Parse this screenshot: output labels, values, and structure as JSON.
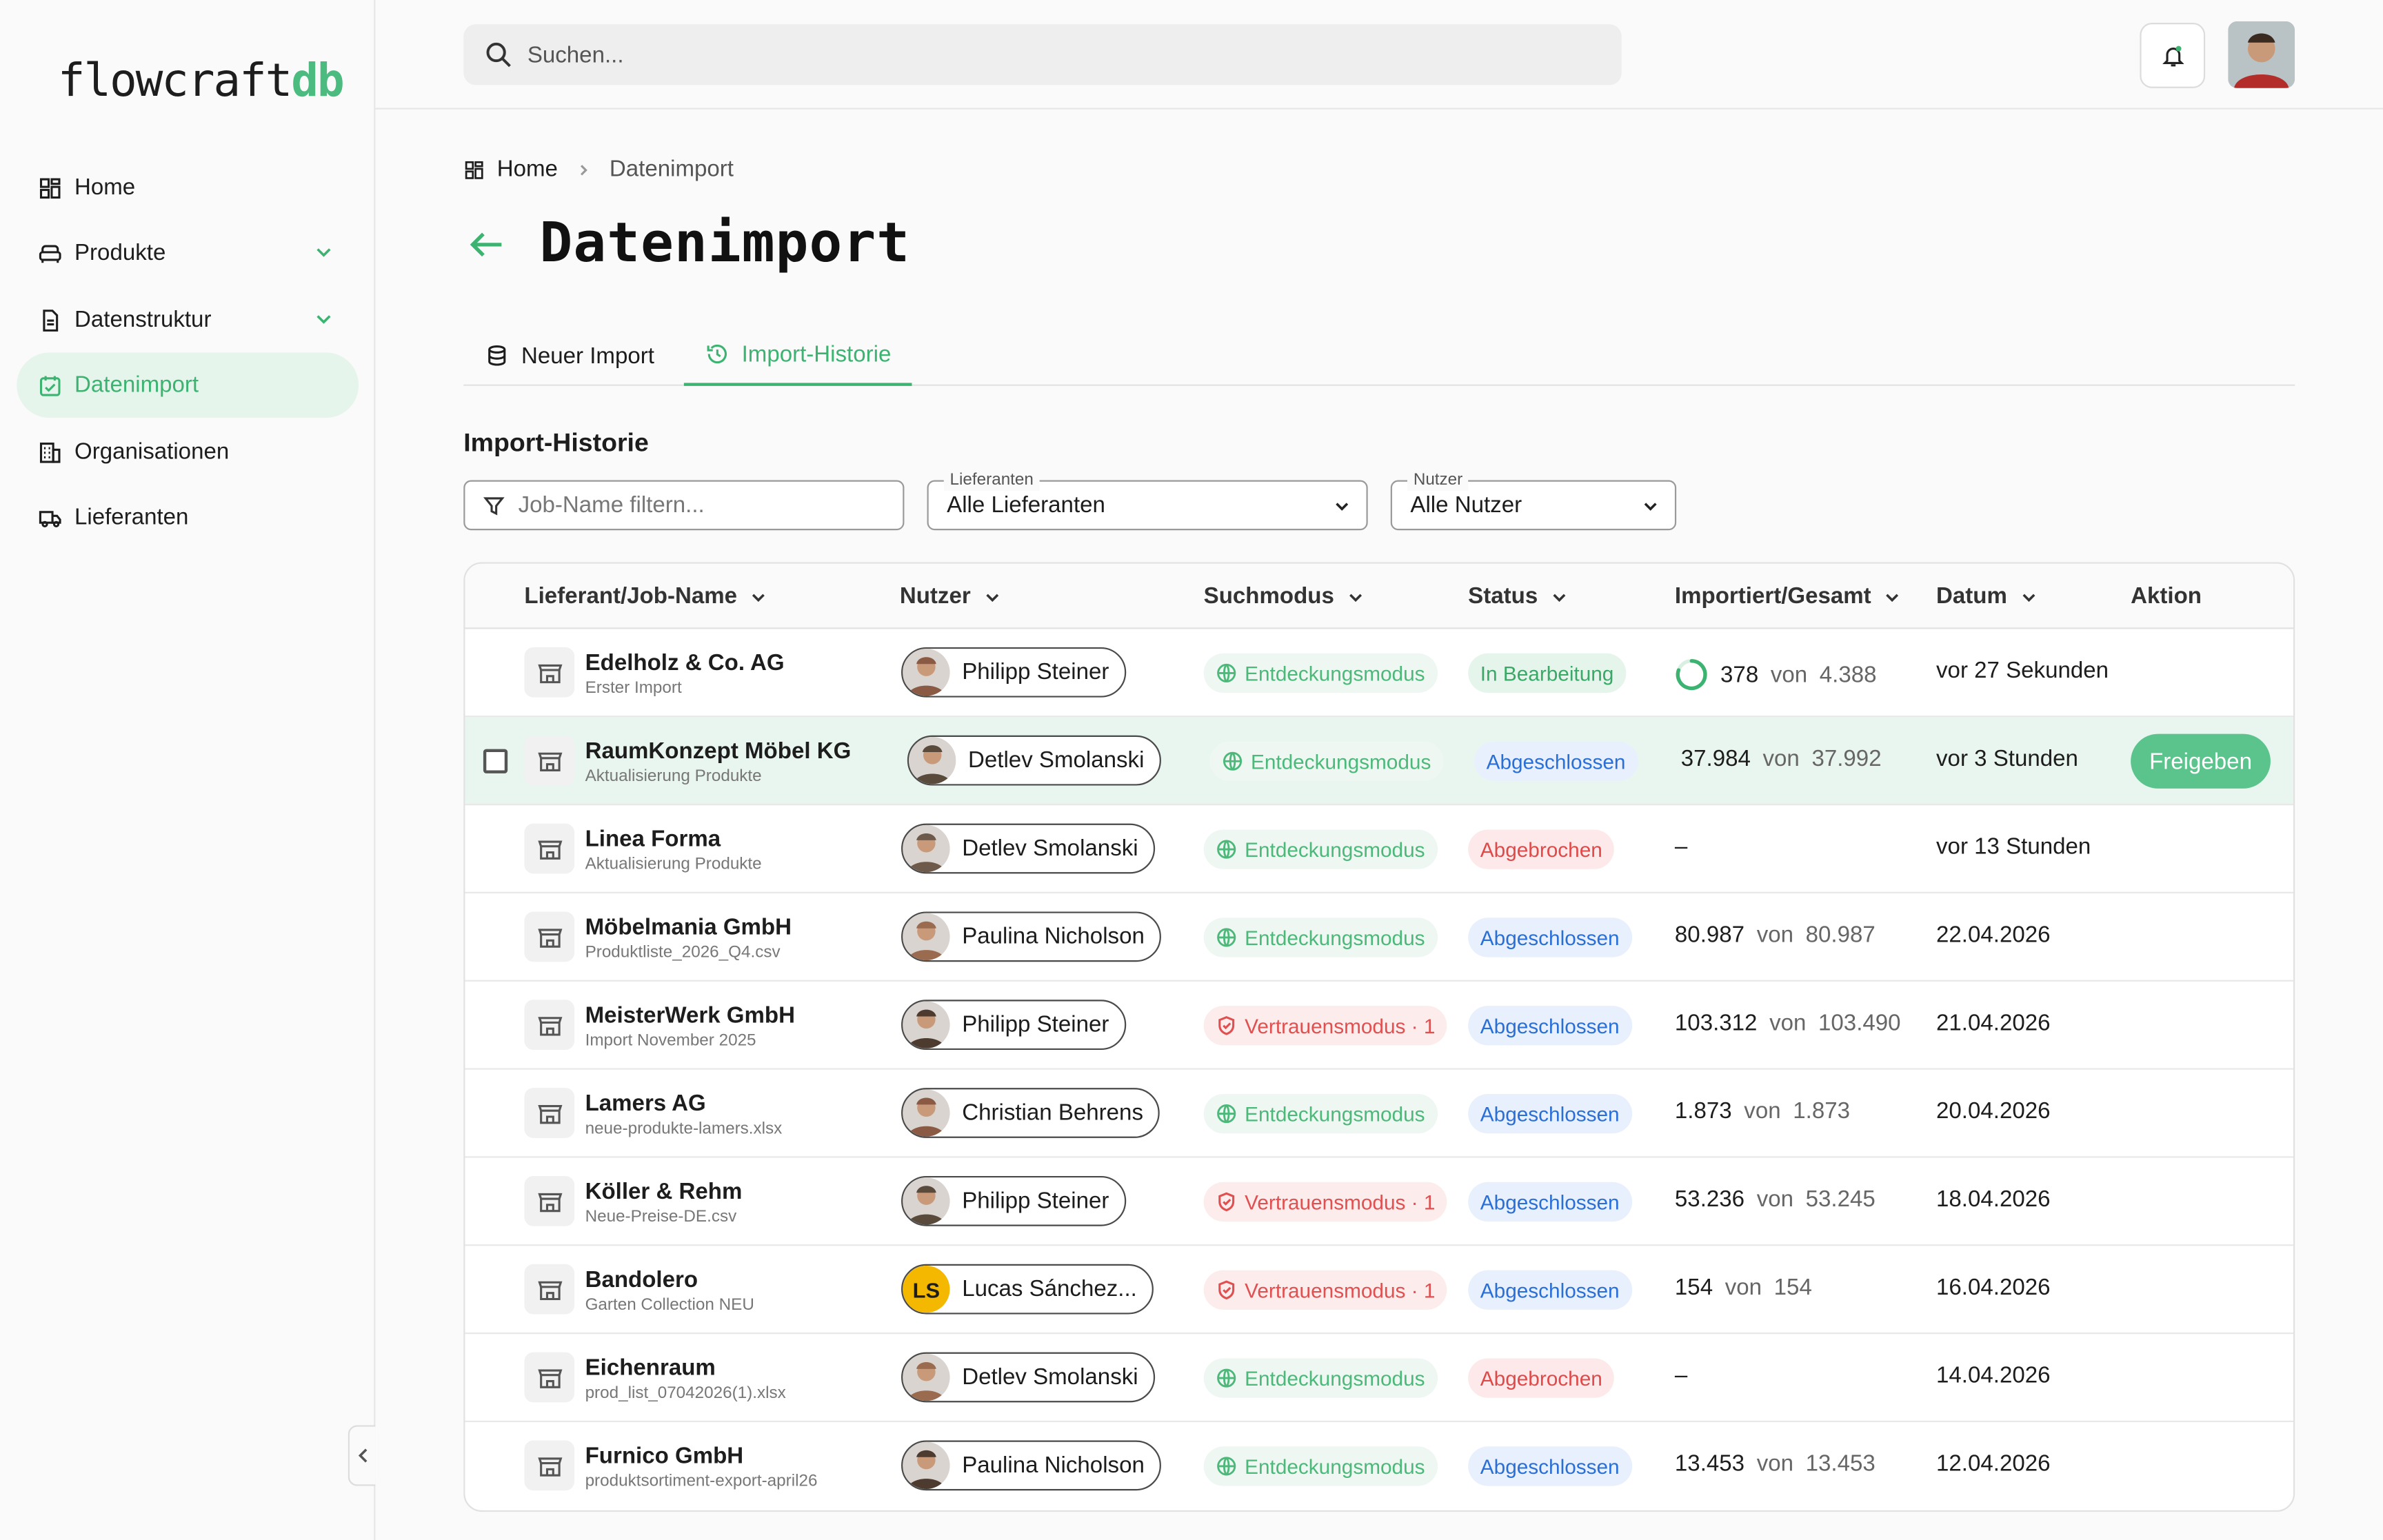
{
  "app": {
    "logo_text": "flowcraft",
    "logo_accent": "db",
    "accent_color": "#3cb371"
  },
  "sidebar": {
    "items": [
      {
        "label": "Home",
        "icon": "dashboard-icon",
        "active": false,
        "expandable": false
      },
      {
        "label": "Produkte",
        "icon": "sofa-icon",
        "active": false,
        "expandable": true
      },
      {
        "label": "Datenstruktur",
        "icon": "document-icon",
        "active": false,
        "expandable": true
      },
      {
        "label": "Datenimport",
        "icon": "calendar-import-icon",
        "active": true,
        "expandable": false
      },
      {
        "label": "Organisationen",
        "icon": "building-icon",
        "active": false,
        "expandable": false
      },
      {
        "label": "Lieferanten",
        "icon": "truck-icon",
        "active": false,
        "expandable": false
      }
    ]
  },
  "topbar": {
    "search_placeholder": "Suchen..."
  },
  "breadcrumb": {
    "home": "Home",
    "current": "Datenimport"
  },
  "page": {
    "title": "Datenimport"
  },
  "tabs": [
    {
      "label": "Neuer Import",
      "icon": "database-icon",
      "active": false
    },
    {
      "label": "Import-Historie",
      "icon": "history-icon",
      "active": true
    }
  ],
  "section": {
    "title": "Import-Historie"
  },
  "filters": {
    "job_placeholder": "Job-Name filtern...",
    "supplier_legend": "Lieferanten",
    "supplier_value": "Alle Lieferanten",
    "user_legend": "Nutzer",
    "user_value": "Alle Nutzer"
  },
  "table": {
    "columns": [
      "Lieferant/Job-Name",
      "Nutzer",
      "Suchmodus",
      "Status",
      "Importiert/Gesamt",
      "Datum",
      "Aktion"
    ],
    "von_label": "von",
    "rows": [
      {
        "supplier": "Edelholz & Co. AG",
        "job": "Erster Import",
        "user": "Philipp Steiner",
        "mode": "Entdeckungsmodus",
        "status": "In Bearbeitung",
        "imported": "378",
        "total": "4.388",
        "date": "vor 27 Sekunden",
        "action": ""
      },
      {
        "supplier": "RaumKonzept Möbel KG",
        "job": "Aktualisierung Produkte",
        "user": "Detlev Smolanski",
        "mode": "Entdeckungsmodus",
        "status": "Abgeschlossen",
        "imported": "37.984",
        "total": "37.992",
        "date": "vor 3 Stunden",
        "action": "Freigeben"
      },
      {
        "supplier": "Linea Forma",
        "job": "Aktualisierung Produkte",
        "user": "Detlev Smolanski",
        "mode": "Entdeckungsmodus",
        "status": "Abgebrochen",
        "imported": "–",
        "total": "",
        "date": "vor 13 Stunden",
        "action": ""
      },
      {
        "supplier": "Möbelmania GmbH",
        "job": "Produktliste_2026_Q4.csv",
        "user": "Paulina Nicholson",
        "mode": "Entdeckungsmodus",
        "status": "Abgeschlossen",
        "imported": "80.987",
        "total": "80.987",
        "date": "22.04.2026",
        "action": ""
      },
      {
        "supplier": "MeisterWerk GmbH",
        "job": "Import November 2025",
        "user": "Philipp Steiner",
        "mode": "Vertrauensmodus · 1",
        "status": "Abgeschlossen",
        "imported": "103.312",
        "total": "103.490",
        "date": "21.04.2026",
        "action": ""
      },
      {
        "supplier": "Lamers AG",
        "job": "neue-produkte-lamers.xlsx",
        "user": "Christian Behrens",
        "mode": "Entdeckungsmodus",
        "status": "Abgeschlossen",
        "imported": "1.873",
        "total": "1.873",
        "date": "20.04.2026",
        "action": ""
      },
      {
        "supplier": "Köller & Rehm",
        "job": "Neue-Preise-DE.csv",
        "user": "Philipp Steiner",
        "mode": "Vertrauensmodus · 1",
        "status": "Abgeschlossen",
        "imported": "53.236",
        "total": "53.245",
        "date": "18.04.2026",
        "action": ""
      },
      {
        "supplier": "Bandolero",
        "job": "Garten Collection NEU",
        "user": "Lucas Sánchez...",
        "user_initials": "LS",
        "mode": "Vertrauensmodus · 1",
        "status": "Abgeschlossen",
        "imported": "154",
        "total": "154",
        "date": "16.04.2026",
        "action": ""
      },
      {
        "supplier": "Eichenraum",
        "job": "prod_list_07042026(1).xlsx",
        "user": "Detlev Smolanski",
        "mode": "Entdeckungsmodus",
        "status": "Abgebrochen",
        "imported": "–",
        "total": "",
        "date": "14.04.2026",
        "action": ""
      },
      {
        "supplier": "Furnico GmbH",
        "job": "produktsortiment-export-april26",
        "user": "Paulina Nicholson",
        "mode": "Entdeckungsmodus",
        "status": "Abgeschlossen",
        "imported": "13.453",
        "total": "13.453",
        "date": "12.04.2026",
        "action": ""
      }
    ]
  }
}
